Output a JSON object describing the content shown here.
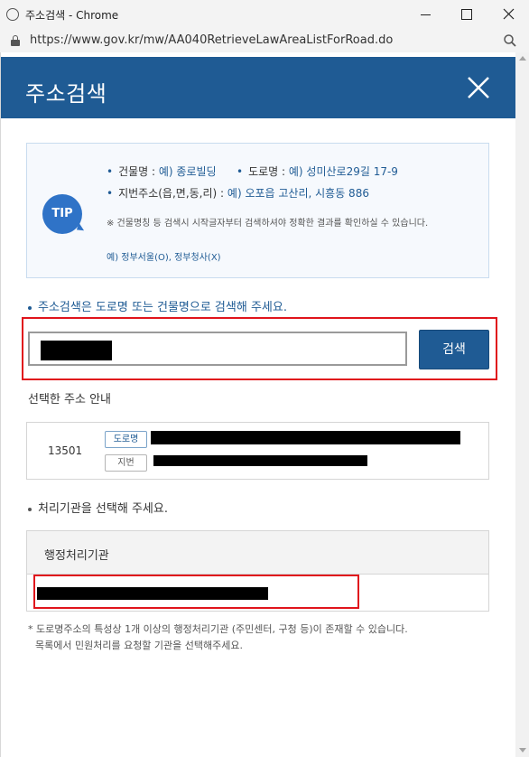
{
  "window": {
    "title": "주소검색 - Chrome",
    "url": "https://www.gov.kr/mw/AA040RetrieveLawAreaListForRoad.do"
  },
  "header": {
    "title": "주소검색"
  },
  "tip": {
    "badge": "TIP",
    "lines": [
      {
        "label": "건물명 :",
        "example": "예) 종로빌딩"
      },
      {
        "label": "도로명 :",
        "example": "예) 성미산로29길 17-9"
      },
      {
        "label": "지번주소(읍,면,동,리) :",
        "example": "예) 오포읍 고산리, 시흥동 886"
      }
    ],
    "note": "※ 건물명칭 등 검색시 시작글자부터 검색하셔야 정확한 결과를 확인하실 수 있습니다.",
    "example": "예) 정부서울(O), 정부청사(X)"
  },
  "search": {
    "instruction": "주소검색은 도로명 또는 건물명으로 검색해 주세요.",
    "button_label": "검색"
  },
  "selected_address": {
    "heading": "선택한 주소 안내",
    "zip": "13501",
    "road_tag": "도로명",
    "lot_tag": "지번"
  },
  "agency": {
    "instruction": "처리기관을 선택해 주세요.",
    "column_header": "행정처리기관"
  },
  "footnote": {
    "line1": "* 도로명주소의 특성상 1개 이상의 행정처리기관 (주민센터, 구청 등)이 존재할 수 있습니다.",
    "line2": "목록에서 민원처리를 요청할 기관을 선택해주세요."
  },
  "colors": {
    "header_bg": "#1f5b94",
    "accent": "#1f5b94",
    "highlight_border": "#e0141c"
  }
}
